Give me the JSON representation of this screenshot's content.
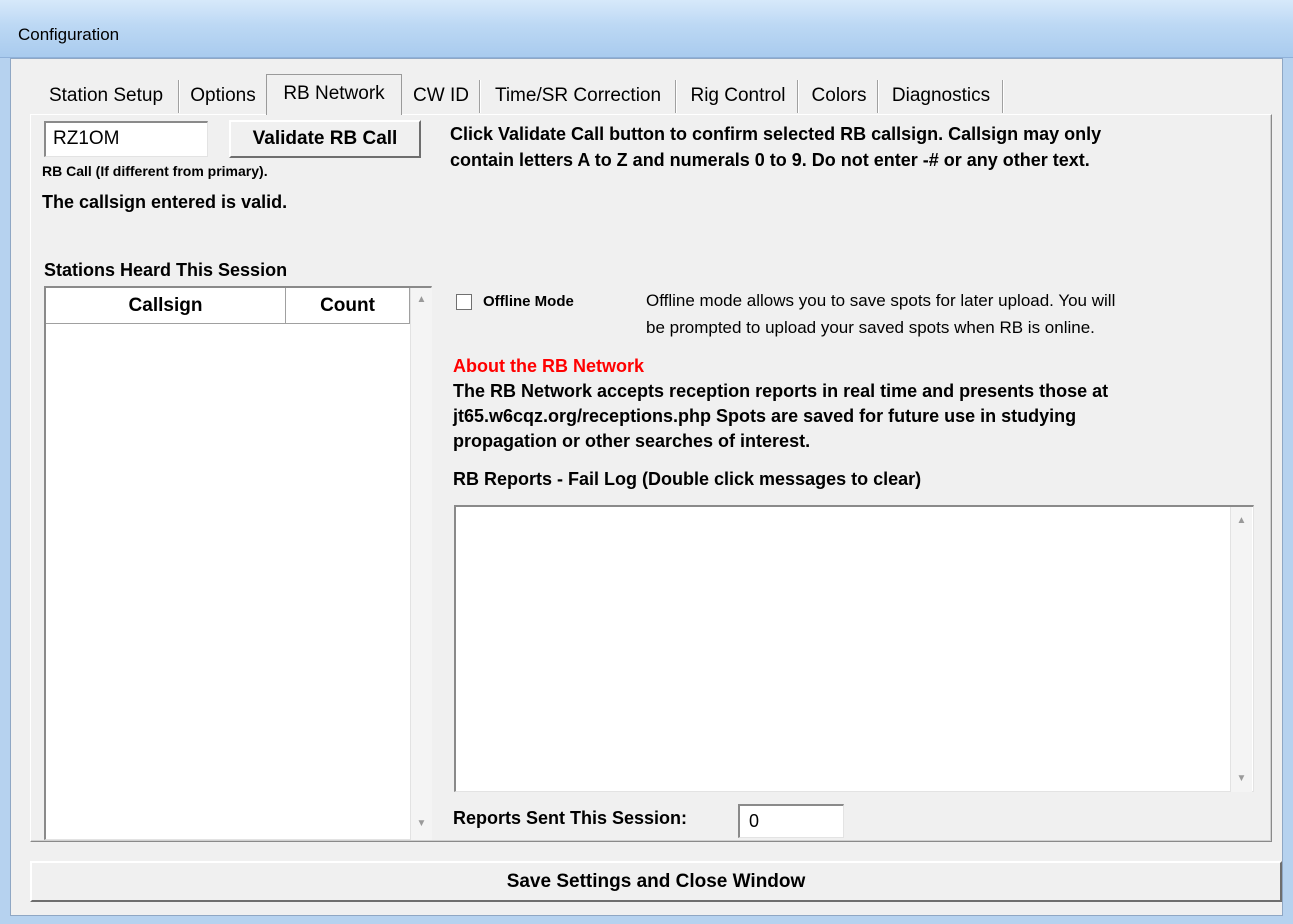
{
  "window": {
    "title": "Configuration"
  },
  "tabs": [
    {
      "label": "Station Setup"
    },
    {
      "label": "Options"
    },
    {
      "label": "RB Network"
    },
    {
      "label": "CW ID"
    },
    {
      "label": "Time/SR Correction"
    },
    {
      "label": "Rig Control"
    },
    {
      "label": "Colors"
    },
    {
      "label": "Diagnostics"
    }
  ],
  "active_tab": "RB Network",
  "rb": {
    "call_value": "RZ1OM",
    "validate_button": "Validate RB Call",
    "call_caption": "RB Call (If different from primary).",
    "valid_message": "The callsign entered is valid.",
    "instructions_line1": "Click Validate Call button to confirm selected RB callsign.  Callsign may only",
    "instructions_line2": "contain letters A to Z and numerals 0 to 9.  Do not enter -# or any other text."
  },
  "stations": {
    "heading": "Stations Heard This Session",
    "col_callsign": "Callsign",
    "col_count": "Count",
    "rows": []
  },
  "offline": {
    "label": "Offline Mode",
    "checked": false,
    "desc_line1": "Offline mode allows you to save spots for later upload.  You will",
    "desc_line2": "be prompted to upload your saved spots when RB is online."
  },
  "about": {
    "heading": "About the RB Network",
    "heading_color": "#ff0000",
    "line1": "The RB Network accepts reception reports in real time and presents those at",
    "line2": "jt65.w6cqz.org/receptions.php  Spots are saved for future use in studying",
    "line3": "propagation or other searches of interest."
  },
  "fail_log": {
    "heading": "RB Reports - Fail Log (Double click messages to clear)",
    "messages": []
  },
  "reports": {
    "label": "Reports Sent This Session:",
    "value": "0"
  },
  "footer": {
    "save_button": "Save Settings and Close Window"
  }
}
